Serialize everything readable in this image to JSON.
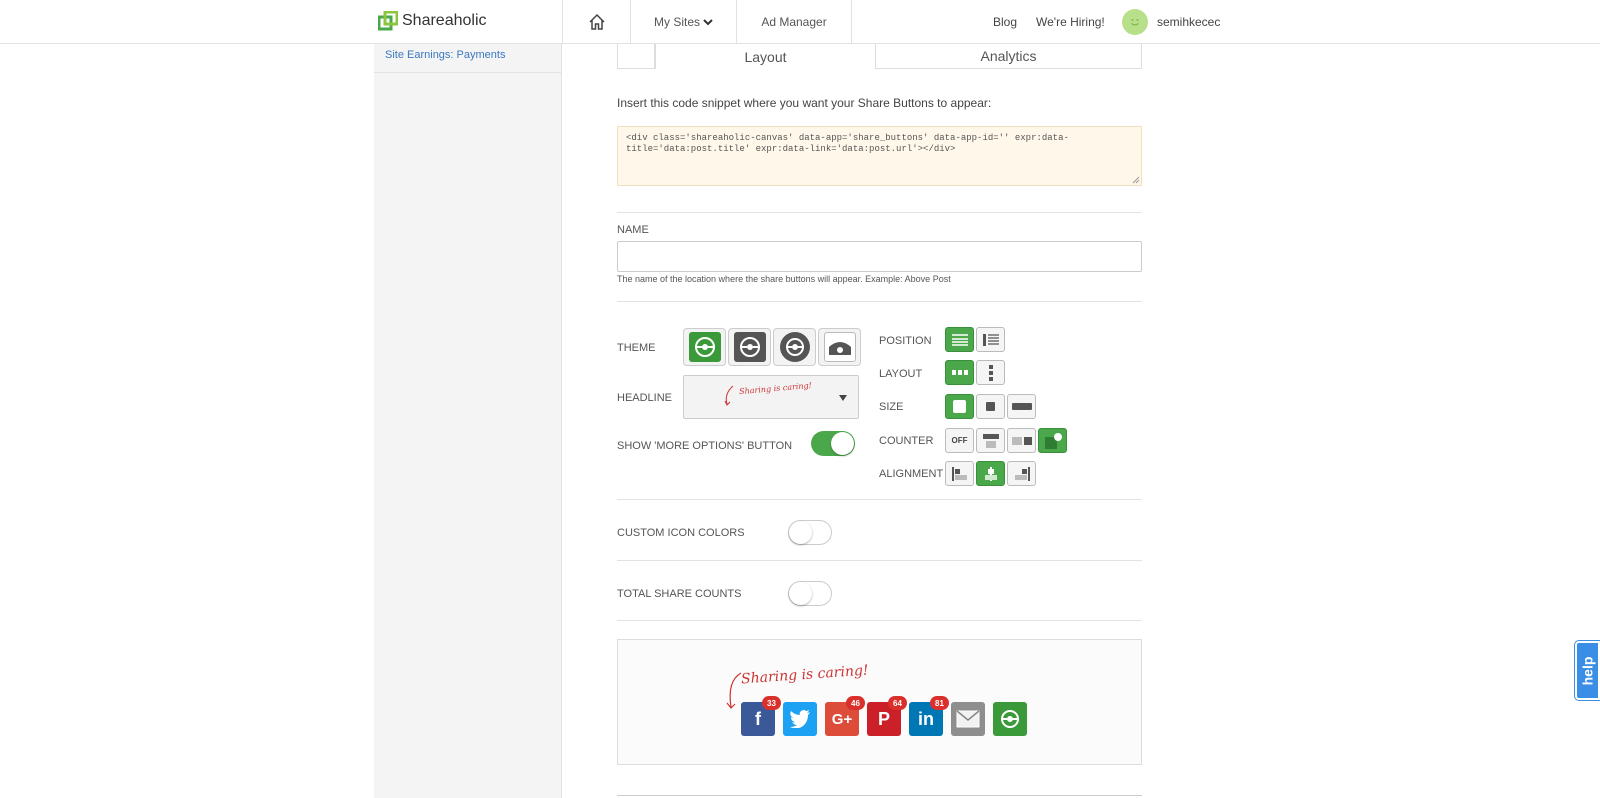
{
  "header": {
    "logo_text": "Shareaholic",
    "nav": {
      "my_sites": "My Sites",
      "ad_manager": "Ad Manager"
    },
    "right": {
      "blog": "Blog",
      "hiring": "We're Hiring!",
      "username": "semihkecec"
    }
  },
  "sidebar": {
    "items": [
      {
        "label": "Site Earnings: Payments"
      }
    ]
  },
  "tabs": [
    {
      "label": ""
    },
    {
      "label": "Layout"
    },
    {
      "label": "Analytics"
    }
  ],
  "snippet": {
    "intro": "Insert this code snippet where you want your Share Buttons to appear:",
    "code_line1": "<div class='shareaholic-canvas' data-app='share_buttons' data-app-id='' expr:data-",
    "code_line2": "title='data:post.title' expr:data-link='data:post.url'></div>"
  },
  "name_field": {
    "label": "NAME",
    "value": "",
    "hint": "The name of the location where the share buttons will appear. Example: Above Post"
  },
  "settings": {
    "theme_label": "THEME",
    "headline_label": "HEADLINE",
    "headline_value": "Sharing is caring!",
    "more_options_label": "SHOW 'MORE OPTIONS' BUTTON",
    "more_options_on": true,
    "position_label": "POSITION",
    "layout_label": "LAYOUT",
    "size_label": "SIZE",
    "counter_label": "COUNTER",
    "counter_off_label": "OFF",
    "alignment_label": "ALIGNMENT",
    "custom_icon_colors_label": "CUSTOM ICON COLORS",
    "custom_icon_colors_on": false,
    "total_share_counts_label": "TOTAL SHARE COUNTS",
    "total_share_counts_on": false
  },
  "preview": {
    "headline": "Sharing is caring!",
    "buttons": [
      {
        "icon": "facebook-icon",
        "glyph": "f",
        "color": "#3b5998",
        "count": "33"
      },
      {
        "icon": "twitter-icon",
        "glyph": "t",
        "color": "#1da1f2",
        "count": ""
      },
      {
        "icon": "google-plus-icon",
        "glyph": "G+",
        "color": "#dd4b39",
        "count": "46"
      },
      {
        "icon": "pinterest-icon",
        "glyph": "P",
        "color": "#cb2027",
        "count": "64"
      },
      {
        "icon": "linkedin-icon",
        "glyph": "in",
        "color": "#0077b5",
        "count": "81"
      },
      {
        "icon": "email-icon",
        "glyph": "✉",
        "color": "#8e8e8e",
        "count": ""
      },
      {
        "icon": "more-options-icon",
        "glyph": "⊕",
        "color": "#3a9a3a",
        "count": ""
      }
    ]
  },
  "help": {
    "label": "help"
  },
  "colors": {
    "accent_green": "#4aa84a",
    "link_blue": "#3a78c2",
    "help_blue": "#3a8ee6"
  }
}
